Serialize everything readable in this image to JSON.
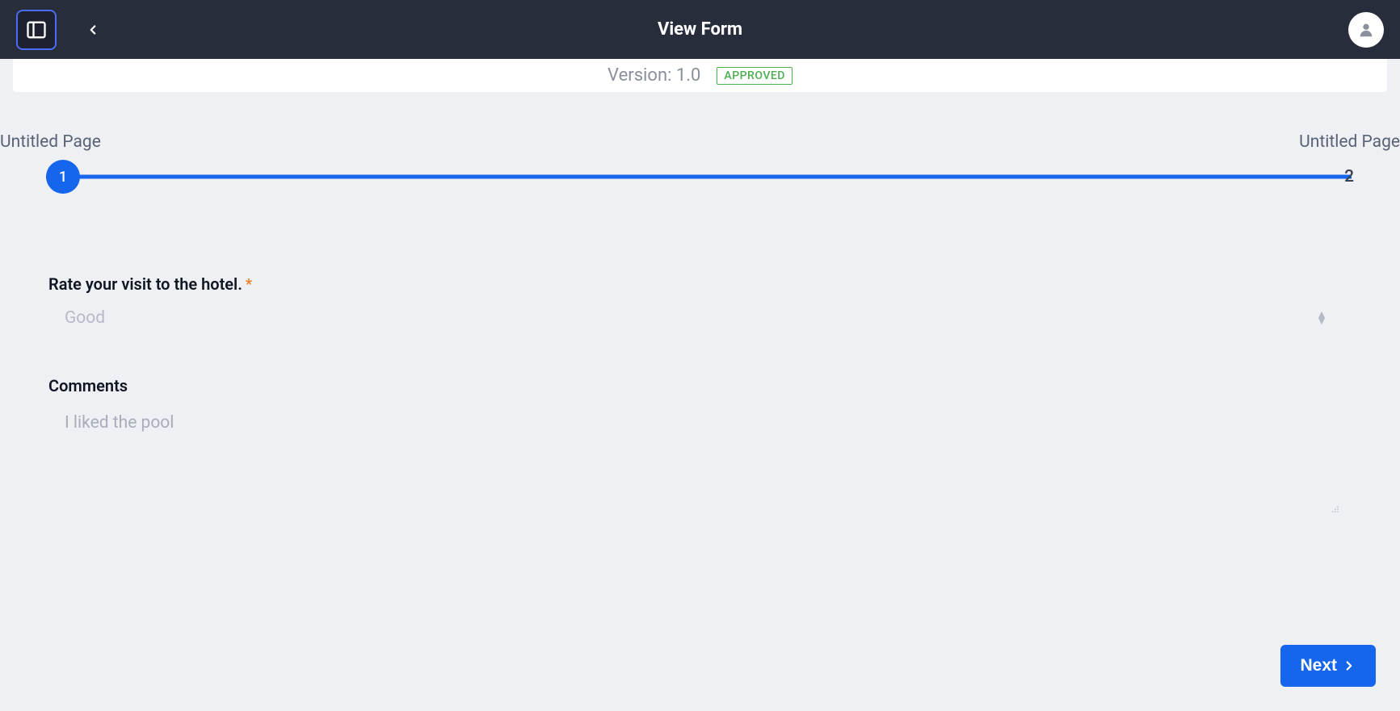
{
  "header": {
    "title": "View Form"
  },
  "version": {
    "label": "Version: 1.0",
    "status": "APPROVED"
  },
  "stepper": {
    "steps": [
      {
        "label": "Untitled Page",
        "number": "1"
      },
      {
        "label": "Untitled Page",
        "number": "2"
      }
    ]
  },
  "form": {
    "fields": [
      {
        "label": "Rate your visit to the hotel.",
        "required": true,
        "value": "Good",
        "type": "select"
      },
      {
        "label": "Comments",
        "required": false,
        "value": "I liked the pool",
        "type": "textarea"
      }
    ]
  },
  "footer": {
    "next_label": "Next"
  }
}
